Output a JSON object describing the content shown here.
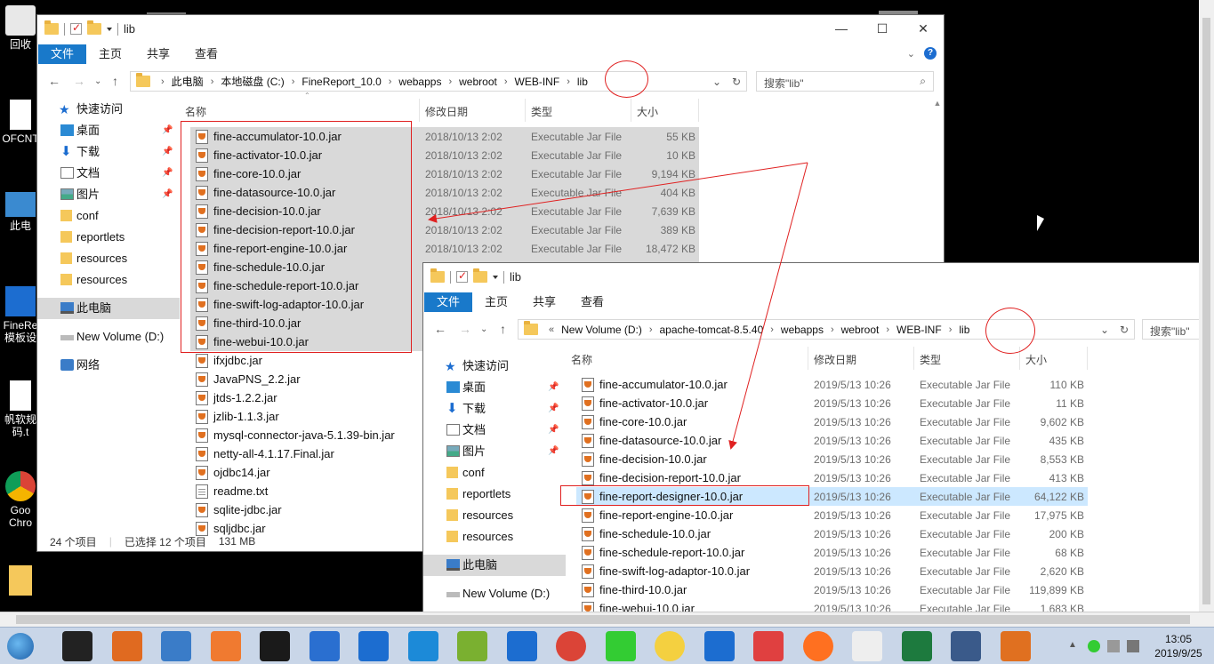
{
  "desktop": {
    "icons": [
      "回收",
      "OFCNT",
      "此电",
      "FineRe 模板设",
      "帆软规 码.t",
      "Goo Chro"
    ]
  },
  "window1": {
    "title": "lib",
    "ribbon_tabs": [
      "文件",
      "主页",
      "共享",
      "查看"
    ],
    "address": [
      "此电脑",
      "本地磁盘 (C:)",
      "FineReport_10.0",
      "webapps",
      "webroot",
      "WEB-INF",
      "lib"
    ],
    "search_placeholder": "搜索\"lib\"",
    "nav": [
      {
        "label": "快速访问",
        "icon": "star-icon"
      },
      {
        "label": "桌面",
        "icon": "desktop-icon",
        "pinned": true
      },
      {
        "label": "下载",
        "icon": "download-icon",
        "pinned": true
      },
      {
        "label": "文档",
        "icon": "document-icon",
        "pinned": true
      },
      {
        "label": "图片",
        "icon": "picture-icon",
        "pinned": true
      },
      {
        "label": "conf",
        "icon": "folder-icon"
      },
      {
        "label": "reportlets",
        "icon": "folder-icon"
      },
      {
        "label": "resources",
        "icon": "folder-icon"
      },
      {
        "label": "resources",
        "icon": "folder-icon"
      },
      {
        "label": "此电脑",
        "icon": "pc-icon",
        "selected": true
      },
      {
        "label": "New Volume (D:)",
        "icon": "drive-icon"
      },
      {
        "label": "网络",
        "icon": "network-icon"
      }
    ],
    "columns": [
      "名称",
      "修改日期",
      "类型",
      "大小"
    ],
    "files": [
      {
        "name": "fine-accumulator-10.0.jar",
        "date": "2018/10/13 2:02",
        "type": "Executable Jar File",
        "size": "55 KB",
        "selected": true
      },
      {
        "name": "fine-activator-10.0.jar",
        "date": "2018/10/13 2:02",
        "type": "Executable Jar File",
        "size": "10 KB",
        "selected": true
      },
      {
        "name": "fine-core-10.0.jar",
        "date": "2018/10/13 2:02",
        "type": "Executable Jar File",
        "size": "9,194 KB",
        "selected": true
      },
      {
        "name": "fine-datasource-10.0.jar",
        "date": "2018/10/13 2:02",
        "type": "Executable Jar File",
        "size": "404 KB",
        "selected": true
      },
      {
        "name": "fine-decision-10.0.jar",
        "date": "2018/10/13 2:02",
        "type": "Executable Jar File",
        "size": "7,639 KB",
        "selected": true
      },
      {
        "name": "fine-decision-report-10.0.jar",
        "date": "2018/10/13 2:02",
        "type": "Executable Jar File",
        "size": "389 KB",
        "selected": true
      },
      {
        "name": "fine-report-engine-10.0.jar",
        "date": "2018/10/13 2:02",
        "type": "Executable Jar File",
        "size": "18,472 KB",
        "selected": true
      },
      {
        "name": "fine-schedule-10.0.jar",
        "date": "",
        "type": "",
        "size": "",
        "selected": true
      },
      {
        "name": "fine-schedule-report-10.0.jar",
        "date": "",
        "type": "",
        "size": "",
        "selected": true
      },
      {
        "name": "fine-swift-log-adaptor-10.0.jar",
        "date": "",
        "type": "",
        "size": "",
        "selected": true
      },
      {
        "name": "fine-third-10.0.jar",
        "date": "",
        "type": "",
        "size": "",
        "selected": true
      },
      {
        "name": "fine-webui-10.0.jar",
        "date": "",
        "type": "",
        "size": "",
        "selected": true
      },
      {
        "name": "ifxjdbc.jar",
        "date": "",
        "type": "",
        "size": ""
      },
      {
        "name": "JavaPNS_2.2.jar",
        "date": "",
        "type": "",
        "size": ""
      },
      {
        "name": "jtds-1.2.2.jar",
        "date": "",
        "type": "",
        "size": ""
      },
      {
        "name": "jzlib-1.1.3.jar",
        "date": "",
        "type": "",
        "size": ""
      },
      {
        "name": "mysql-connector-java-5.1.39-bin.jar",
        "date": "",
        "type": "",
        "size": ""
      },
      {
        "name": "netty-all-4.1.17.Final.jar",
        "date": "",
        "type": "",
        "size": ""
      },
      {
        "name": "ojdbc14.jar",
        "date": "",
        "type": "",
        "size": ""
      },
      {
        "name": "readme.txt",
        "date": "",
        "type": "",
        "size": "",
        "txt": true
      },
      {
        "name": "sqlite-jdbc.jar",
        "date": "",
        "type": "",
        "size": ""
      },
      {
        "name": "sqljdbc.jar",
        "date": "",
        "type": "",
        "size": ""
      }
    ],
    "status": {
      "count": "24 个项目",
      "selection": "已选择 12 个项目",
      "size": "131 MB"
    }
  },
  "window2": {
    "title": "lib",
    "ribbon_tabs": [
      "文件",
      "主页",
      "共享",
      "查看"
    ],
    "address_prefix": "«",
    "address": [
      "New Volume (D:)",
      "apache-tomcat-8.5.40",
      "webapps",
      "webroot",
      "WEB-INF",
      "lib"
    ],
    "search_placeholder": "搜索\"lib\"",
    "nav": [
      {
        "label": "快速访问",
        "icon": "star-icon"
      },
      {
        "label": "桌面",
        "icon": "desktop-icon",
        "pinned": true
      },
      {
        "label": "下载",
        "icon": "download-icon",
        "pinned": true
      },
      {
        "label": "文档",
        "icon": "document-icon",
        "pinned": true
      },
      {
        "label": "图片",
        "icon": "picture-icon",
        "pinned": true
      },
      {
        "label": "conf",
        "icon": "folder-icon"
      },
      {
        "label": "reportlets",
        "icon": "folder-icon"
      },
      {
        "label": "resources",
        "icon": "folder-icon"
      },
      {
        "label": "resources",
        "icon": "folder-icon"
      },
      {
        "label": "此电脑",
        "icon": "pc-icon",
        "selected": true
      },
      {
        "label": "New Volume (D:)",
        "icon": "drive-icon"
      }
    ],
    "columns": [
      "名称",
      "修改日期",
      "类型",
      "大小"
    ],
    "files": [
      {
        "name": "fine-accumulator-10.0.jar",
        "date": "2019/5/13 10:26",
        "type": "Executable Jar File",
        "size": "110 KB"
      },
      {
        "name": "fine-activator-10.0.jar",
        "date": "2019/5/13 10:26",
        "type": "Executable Jar File",
        "size": "11 KB"
      },
      {
        "name": "fine-core-10.0.jar",
        "date": "2019/5/13 10:26",
        "type": "Executable Jar File",
        "size": "9,602 KB"
      },
      {
        "name": "fine-datasource-10.0.jar",
        "date": "2019/5/13 10:26",
        "type": "Executable Jar File",
        "size": "435 KB"
      },
      {
        "name": "fine-decision-10.0.jar",
        "date": "2019/5/13 10:26",
        "type": "Executable Jar File",
        "size": "8,553 KB"
      },
      {
        "name": "fine-decision-report-10.0.jar",
        "date": "2019/5/13 10:26",
        "type": "Executable Jar File",
        "size": "413 KB"
      },
      {
        "name": "fine-report-designer-10.0.jar",
        "date": "2019/5/13 10:26",
        "type": "Executable Jar File",
        "size": "64,122 KB",
        "highlighted": true
      },
      {
        "name": "fine-report-engine-10.0.jar",
        "date": "2019/5/13 10:26",
        "type": "Executable Jar File",
        "size": "17,975 KB"
      },
      {
        "name": "fine-schedule-10.0.jar",
        "date": "2019/5/13 10:26",
        "type": "Executable Jar File",
        "size": "200 KB"
      },
      {
        "name": "fine-schedule-report-10.0.jar",
        "date": "2019/5/13 10:26",
        "type": "Executable Jar File",
        "size": "68 KB"
      },
      {
        "name": "fine-swift-log-adaptor-10.0.jar",
        "date": "2019/5/13 10:26",
        "type": "Executable Jar File",
        "size": "2,620 KB"
      },
      {
        "name": "fine-third-10.0.jar",
        "date": "2019/5/13 10:26",
        "type": "Executable Jar File",
        "size": "119,899 KB"
      },
      {
        "name": "fine-webui-10.0.jar",
        "date": "2019/5/13 10:26",
        "type": "Executable Jar File",
        "size": "1,683 KB"
      }
    ]
  },
  "taskbar": {
    "apps": [
      "intellij-icon",
      "app-icon",
      "remote-desktop-icon",
      "editor-icon",
      "webstorm-icon",
      "note-icon",
      "teamviewer-icon",
      "network-tool-icon",
      "vmware-icon",
      "finereport-icon",
      "chrome-icon",
      "wechat-icon",
      "emoji-icon",
      "map-icon",
      "snail-icon",
      "firefox-icon",
      "panda-icon",
      "excel-icon",
      "remote-icon",
      "java-icon"
    ],
    "time": "13:05",
    "date": "2019/9/25"
  },
  "colors": {
    "accent": "#1979ca",
    "annotation": "#e02020",
    "selection": "#d9d9d9",
    "highlight": "#cce8ff"
  }
}
